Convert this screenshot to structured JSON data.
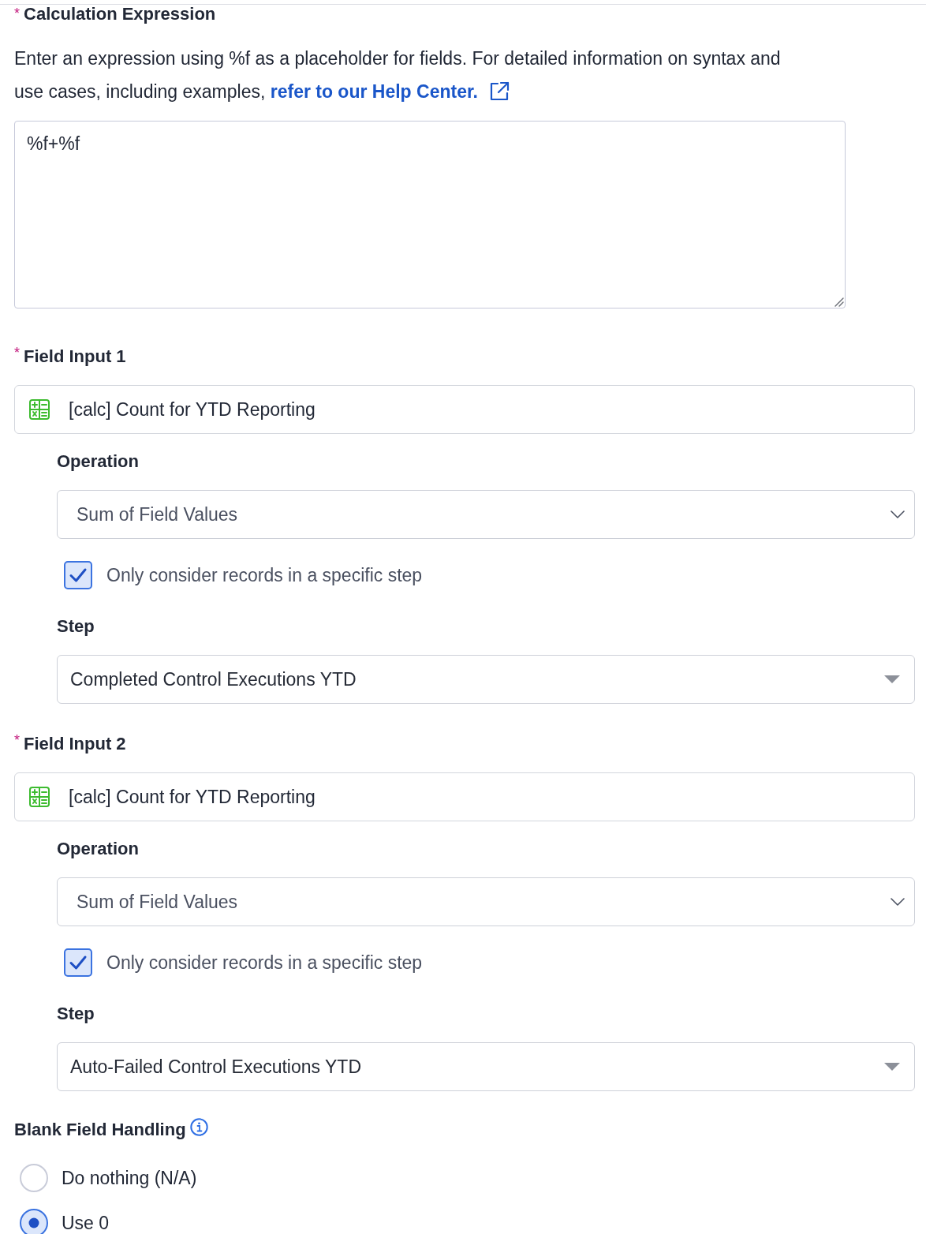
{
  "calculation_expression": {
    "required_mark": "*",
    "label": "Calculation Expression",
    "description": "Enter an expression using %f as a placeholder for fields. For detailed information on syntax and use cases, including examples,",
    "help_link": "refer to our Help Center.",
    "value": "%f+%f"
  },
  "field_inputs": [
    {
      "required_mark": "*",
      "label": "Field Input 1",
      "value": "[calc] Count for YTD Reporting",
      "operation": {
        "label": "Operation",
        "value": "Sum of Field Values"
      },
      "step_filter": {
        "label": "Only consider records in a specific step",
        "checked": true
      },
      "step": {
        "label": "Step",
        "value": "Completed Control Executions YTD"
      }
    },
    {
      "required_mark": "*",
      "label": "Field Input 2",
      "value": "[calc] Count for YTD Reporting",
      "operation": {
        "label": "Operation",
        "value": "Sum of Field Values"
      },
      "step_filter": {
        "label": "Only consider records in a specific step",
        "checked": true
      },
      "step": {
        "label": "Step",
        "value": "Auto-Failed Control Executions YTD"
      }
    }
  ],
  "blank_field_handling": {
    "label": "Blank Field Handling",
    "options": [
      {
        "label": "Do nothing (N/A)",
        "selected": false
      },
      {
        "label": "Use 0",
        "selected": true
      }
    ]
  }
}
